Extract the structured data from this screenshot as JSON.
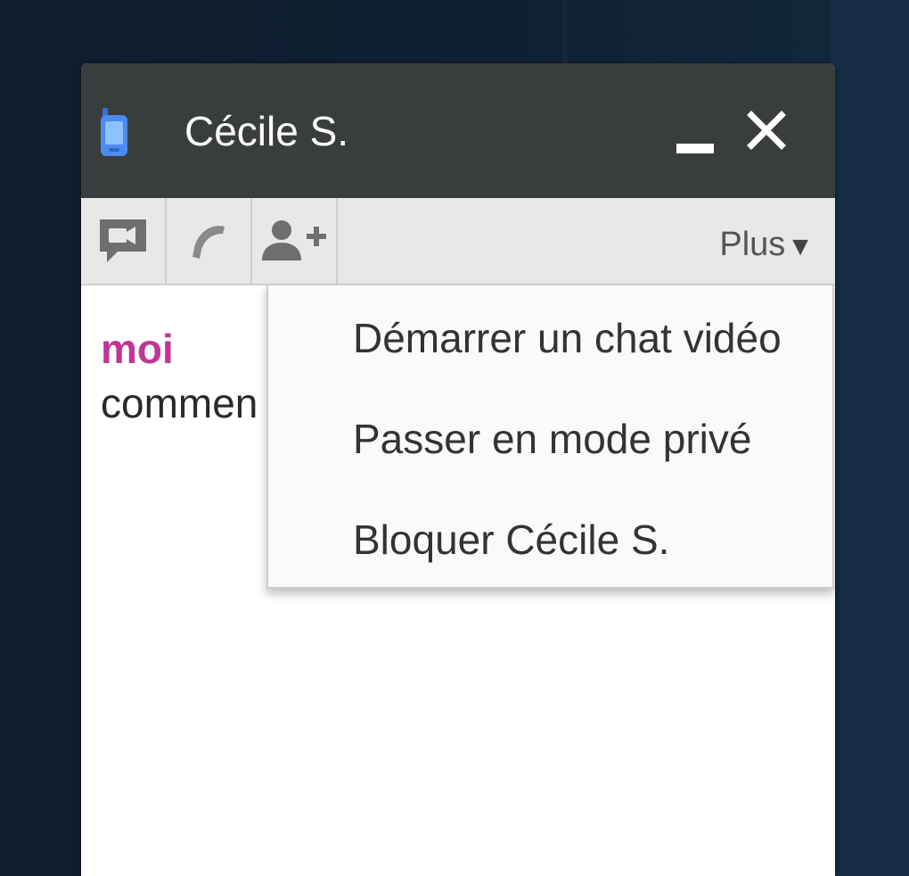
{
  "chat_window": {
    "contact_name": "Cécile S.",
    "status_icon": "mobile-phone-icon",
    "minimize_icon": "minimize-icon",
    "close_icon": "close-icon"
  },
  "toolbar": {
    "video_icon": "video-chat-icon",
    "call_icon": "phone-call-icon",
    "add_person_icon": "add-person-icon",
    "more_label": "Plus",
    "more_arrow": "▼"
  },
  "conversation": {
    "messages": [
      {
        "author": "moi",
        "text": "commen"
      }
    ]
  },
  "dropdown_menu": {
    "items": [
      {
        "label": "Démarrer un chat vidéo"
      },
      {
        "label": "Passer en mode privé"
      },
      {
        "label": "Bloquer Cécile S."
      }
    ]
  },
  "colors": {
    "titlebar": "#3a3d3d",
    "toolbar": "#e8e8e8",
    "author": "#c03596",
    "phone_icon": "#4a8cf0",
    "background": "#0f1f30"
  }
}
